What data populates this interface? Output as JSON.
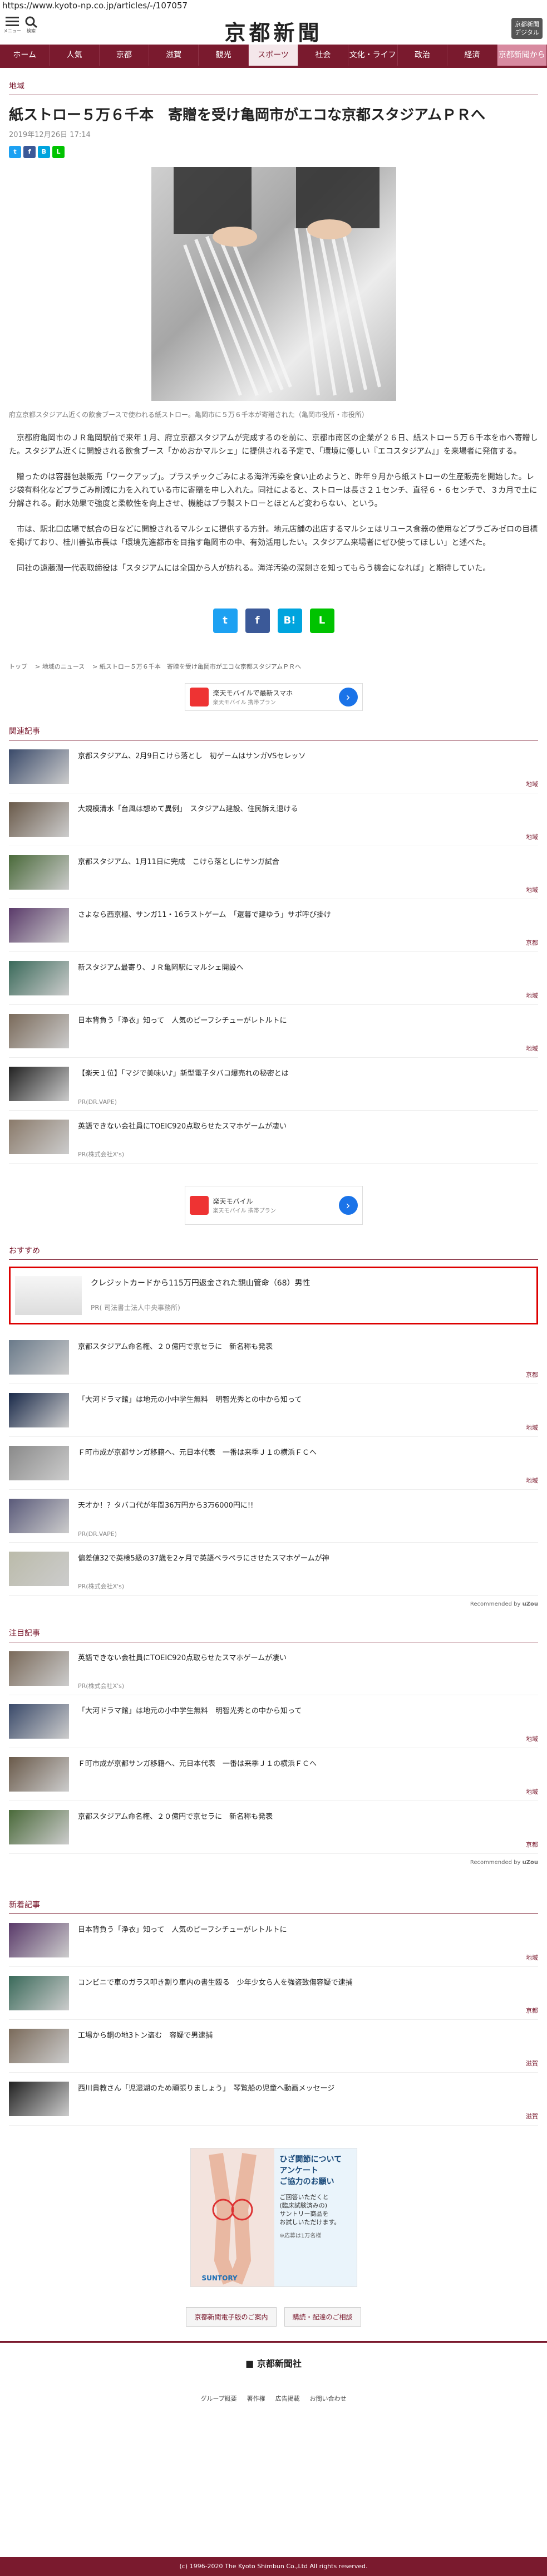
{
  "browser": {
    "url": "https://www.kyoto-np.co.jp/articles/-/107057"
  },
  "header": {
    "menu_label": "メニュー",
    "search_label": "検索",
    "logo": "京都新聞",
    "register_label": "京都新聞\nデジタル"
  },
  "nav": {
    "items": [
      "ホーム",
      "人気",
      "京都",
      "滋賀",
      "観光",
      "スポーツ",
      "社会",
      "文化・ライフ",
      "政治",
      "経済",
      "京都新聞から"
    ],
    "active": "スポーツ"
  },
  "article": {
    "category": "地域",
    "title": "紙ストロー５万６千本　寄贈を受け亀岡市がエコな京都スタジアムＰＲへ",
    "date": "2019年12月26日 17:14",
    "photo_caption": "府立京都スタジアム近くの飲食ブースで使われる紙ストロー。亀岡市に５万６千本が寄贈された（亀岡市役所・市役所）",
    "paragraphs": [
      "京都府亀岡市のＪＲ亀岡駅前で来年１月、府立京都スタジアムが完成するのを前に、京都市南区の企業が２６日、紙ストロー５万６千本を市へ寄贈した。スタジアム近くに開設される飲食ブース「かめおかマルシェ」に提供される予定で、「環境に優しい『エコスタジアム』」を来場者に発信する。",
      "贈ったのは容器包装販売「ワークアップ」。プラスチックごみによる海洋汚染を食い止めようと、昨年９月から紙ストローの生産販売を開始した。レジ袋有料化などプラごみ削減に力を入れている市に寄贈を申し入れた。同社によると、ストローは長さ２１センチ、直径６・６センチで、３カ月で土に分解される。耐水効果で強度と柔軟性を向上させ、機能はプラ製ストローとほとんど変わらない、という。",
      "市は、駅北口広場で試合の日などに開設されるマルシェに提供する方針。地元店舗の出店するマルシェはリユース食器の使用などプラごみゼロの目標を掲げており、桂川善弘市長は「環境先進都市を目指す亀岡市の中、有効活用したい。スタジアム来場者にぜひ使ってほしい」と述べた。",
      "同社の遠藤潤一代表取締役は「スタジアムには全国から人が訪れる。海洋汚染の深刻さを知ってもらう機会になれば」と期待していた。"
    ],
    "breadcrumbs": [
      "トップ",
      "地域のニュース",
      "紙ストロー５万６千本　寄贈を受け亀岡市がエコな京都スタジアムＰＲへ"
    ]
  },
  "ad1": {
    "title": "楽天モバイルで最新スマホ",
    "sub": "楽天モバイル 携帯プラン"
  },
  "related": {
    "label": "関連記事",
    "items": [
      {
        "text": "京都スタジアム、2月9日こけら落とし　初ゲームはサンガVSセレッソ",
        "tag": "地域"
      },
      {
        "text": "大規模清水「台風は想めて異例」　スタジアム建設、住民訴え退ける",
        "tag": "地域"
      },
      {
        "text": "京都スタジアム、1月11日に完成　こけら落としにサンガ試合",
        "tag": "地域"
      },
      {
        "text": "さよなら西京極、サンガ11・16ラストゲーム　「還暮で建ゆう」サポ呼び掛け",
        "tag": "京都"
      },
      {
        "text": "新スタジアム最寄り、ＪＲ亀岡駅にマルシェ開設へ",
        "tag": "地域"
      },
      {
        "text": "日本背負う「浄衣」知って　人気のピーフシチューがレトルトに",
        "tag": "地域"
      },
      {
        "text": "【楽天１位】「マジで美味い♪」新型電子タバコ爆売れの秘密とは",
        "tag": "PR(DR.VAPE)"
      },
      {
        "text": "英語できない会社員にTOEIC920点取らせたスマホゲームが凄い",
        "tag": "PR(株式会社X's)"
      }
    ]
  },
  "ad2": {
    "title": "楽天モバイル",
    "sub": "楽天モバイル 携帯プラン"
  },
  "recommend": {
    "label": "おすすめ",
    "highlight": {
      "text": "クレジットカードから115万円返金された親山管命（68）男性",
      "tag": "PR( 司法書士法人中央事務所)"
    },
    "items": [
      {
        "text": "京都スタジアム命名権、２０億円で京セラに　新名称も発表",
        "tag": "京都"
      },
      {
        "text": "「大河ドラマ館」は地元の小中学生無料　明智光秀との中から知って",
        "tag": "地域"
      },
      {
        "text": "Ｆ町市成が京都サンガ移籍へ、元日本代表　一番は来季Ｊ１の横浜ＦＣへ",
        "tag": "地域"
      },
      {
        "text": "天才か！？タバコ代が年間36万円から3万6000円に!!",
        "tag": "PR(DR.VAPE)"
      },
      {
        "text": "偏差値32で英検5級の37歳を2ヶ月で英語ペラペラにさせたスマホゲームが神",
        "tag": "PR(株式会社X's)"
      }
    ],
    "recommended_by": "Recommended by"
  },
  "attention": {
    "label": "注目記事",
    "items": [
      {
        "text": "英語できない会社員にTOEIC920点取らせたスマホゲームが凄い",
        "tag": "PR(株式会社X's)"
      },
      {
        "text": "「大河ドラマ館」は地元の小中学生無料　明智光秀との中から知って",
        "tag": "地域"
      },
      {
        "text": "Ｆ町市成が京都サンガ移籍へ、元日本代表　一番は来季Ｊ１の横浜ＦＣへ",
        "tag": "地域"
      },
      {
        "text": "京都スタジアム命名権、２０億円で京セラに　新名称も発表",
        "tag": "京都"
      }
    ],
    "recommended_by": "Recommended by"
  },
  "latest": {
    "label": "新着記事",
    "items": [
      {
        "text": "日本背負う「浄衣」知って　人気のピーフシチューがレトルトに",
        "tag": "地域"
      },
      {
        "text": "コンビニで車のガラス叩き割り車内の書生殴る　少年少女ら人を強盗致傷容疑で逮捕",
        "tag": "京都"
      },
      {
        "text": "工場から銅の地3トン盗む　容疑で男逮捕",
        "tag": "滋賀"
      },
      {
        "text": "西川貴教さん「児湿湖のため頑張りましょう」　琴覧船の児童へ動画メッセージ",
        "tag": "滋賀"
      }
    ]
  },
  "bigad": {
    "text": "ひざ関節について\nアンケート\nご協力のお願い",
    "sub": "ご回答いただくと\n(臨床試験済みの)\nサントリー商品を\nお試しいただけます。",
    "note": "※応募は1万名様",
    "brand": "SUNTORY"
  },
  "footer": {
    "buttons": [
      "京都新聞電子版のご案内",
      "購読・配達のご相談"
    ],
    "logo": "京都新聞社",
    "links": [
      "グループ概要",
      "著作権",
      "広告掲載",
      "お問い合わせ"
    ],
    "copyright": "(c) 1996-2020 The Kyoto Shimbun Co.,Ltd All rights reserved."
  }
}
